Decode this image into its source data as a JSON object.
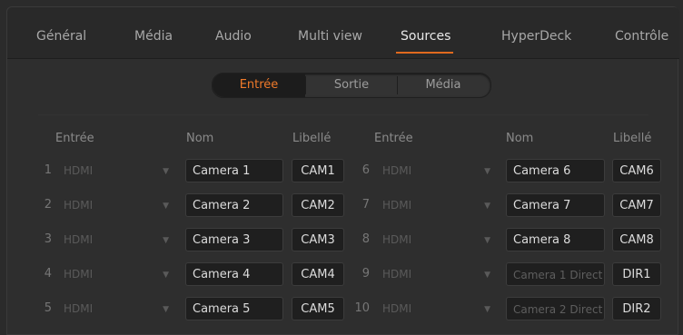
{
  "tabs": [
    "Général",
    "Média",
    "Audio",
    "Multi view",
    "Sources",
    "HyperDeck",
    "Contrôle"
  ],
  "active_tab": "Sources",
  "segments": [
    "Entrée",
    "Sortie",
    "Média"
  ],
  "active_segment": "Entrée",
  "columns": {
    "left": {
      "input": "Entrée",
      "name": "Nom",
      "label": "Libellé"
    },
    "right": {
      "input": "Entrée",
      "name": "Nom",
      "label": "Libellé"
    }
  },
  "rows_left": [
    {
      "num": "1",
      "input": "HDMI",
      "name": "Camera 1",
      "label": "CAM1"
    },
    {
      "num": "2",
      "input": "HDMI",
      "name": "Camera 2",
      "label": "CAM2"
    },
    {
      "num": "3",
      "input": "HDMI",
      "name": "Camera 3",
      "label": "CAM3"
    },
    {
      "num": "4",
      "input": "HDMI",
      "name": "Camera 4",
      "label": "CAM4"
    },
    {
      "num": "5",
      "input": "HDMI",
      "name": "Camera 5",
      "label": "CAM5"
    }
  ],
  "rows_right": [
    {
      "num": "6",
      "input": "HDMI",
      "name": "Camera 6",
      "label": "CAM6"
    },
    {
      "num": "7",
      "input": "HDMI",
      "name": "Camera 7",
      "label": "CAM7"
    },
    {
      "num": "8",
      "input": "HDMI",
      "name": "Camera 8",
      "label": "CAM8"
    },
    {
      "num": "9",
      "input": "HDMI",
      "name": "",
      "name_placeholder": "Camera 1 Direct",
      "label": "DIR1"
    },
    {
      "num": "10",
      "input": "HDMI",
      "name": "",
      "name_placeholder": "Camera 2 Direct",
      "label": "DIR2"
    }
  ],
  "colors": {
    "accent": "#e06a1e",
    "active_segment_text": "#f07a2a"
  }
}
